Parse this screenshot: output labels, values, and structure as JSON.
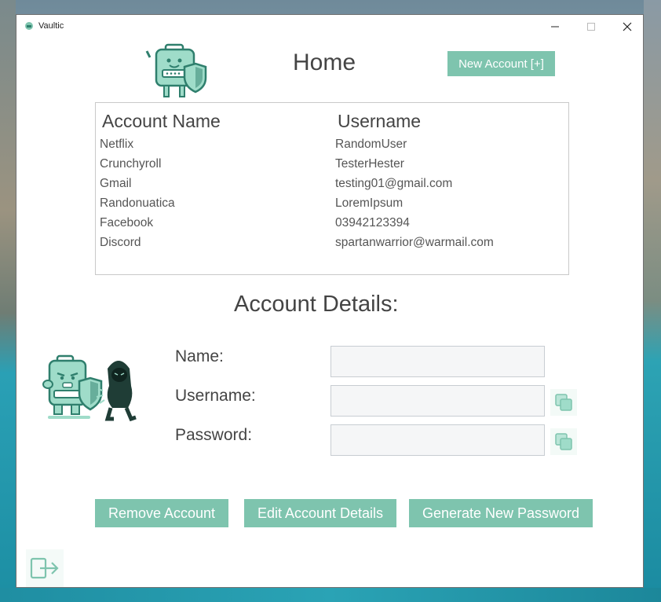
{
  "window": {
    "title": "Vaultic",
    "min_icon": "minimize-icon",
    "max_icon": "maximize-icon",
    "close_icon": "close-icon"
  },
  "header": {
    "title": "Home",
    "new_account_label": "New Account [+]"
  },
  "accounts": {
    "columns": [
      "Account Name",
      "Username"
    ],
    "rows": [
      {
        "name": "Netflix",
        "username": "RandomUser"
      },
      {
        "name": "Crunchyroll",
        "username": "TesterHester"
      },
      {
        "name": "Gmail",
        "username": "testing01@gmail.com"
      },
      {
        "name": "Randonuatica",
        "username": "LoremIpsum"
      },
      {
        "name": "Facebook",
        "username": "03942123394"
      },
      {
        "name": "Discord",
        "username": "spartanwarrior@warmail.com"
      }
    ]
  },
  "details": {
    "title": "Account Details:",
    "name_label": "Name:",
    "username_label": "Username:",
    "password_label": "Password:",
    "name_value": "",
    "username_value": "",
    "password_value": ""
  },
  "actions": {
    "remove_label": "Remove Account",
    "edit_label": "Edit Account Details",
    "generate_label": "Generate New Password"
  },
  "colors": {
    "accent": "#7ec4ae",
    "mascot": "#9fdcc9",
    "outline": "#2f7f6d"
  }
}
